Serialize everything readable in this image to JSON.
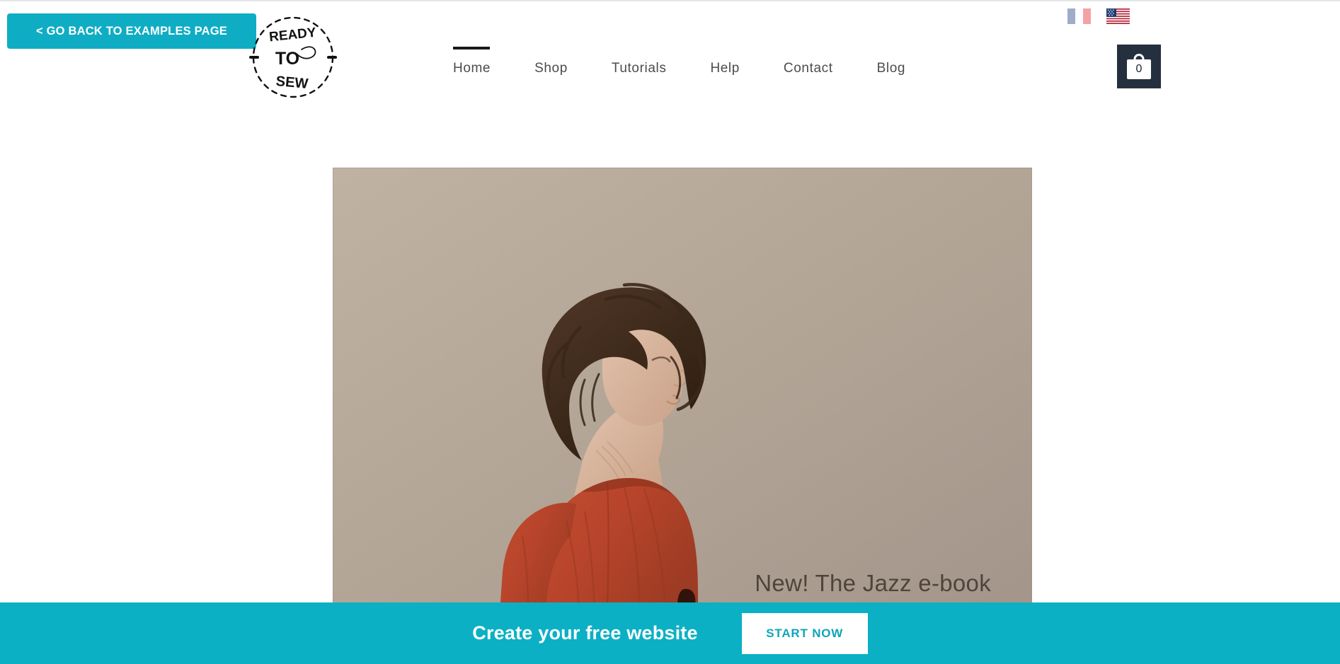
{
  "colors": {
    "teal": "#0BB0C4",
    "teal_button": "#0FADC4",
    "cart_background": "#25303E",
    "nav_text": "#4C4C4C",
    "active_underline": "#1A1A1A",
    "hero_background": "#B0A294",
    "hero_caption_text": "#4E443C",
    "start_now_text": "#0FA5B9"
  },
  "back_button": {
    "label": "< GO BACK TO EXAMPLES PAGE",
    "icon": "chevron-left-icon"
  },
  "logo": {
    "line1": "READY",
    "line2": "TO",
    "line3": "SEW",
    "alt": "Ready To Sew circular stamp logo with needle and thread"
  },
  "nav": {
    "items": [
      {
        "label": "Home",
        "active": true
      },
      {
        "label": "Shop",
        "active": false
      },
      {
        "label": "Tutorials",
        "active": false
      },
      {
        "label": "Help",
        "active": false
      },
      {
        "label": "Contact",
        "active": false
      },
      {
        "label": "Blog",
        "active": false
      }
    ]
  },
  "languages": [
    {
      "name": "french-flag",
      "code": "FR",
      "active": false
    },
    {
      "name": "us-flag",
      "code": "US",
      "active": true
    }
  ],
  "cart": {
    "count": "0",
    "icon": "shopping-bag-icon"
  },
  "hero": {
    "caption": "New! The Jazz e-book",
    "alt": "Woman seen from behind wearing a rust orange top against a beige backdrop"
  },
  "banner": {
    "text": "Create your free website",
    "button_label": "START NOW"
  }
}
